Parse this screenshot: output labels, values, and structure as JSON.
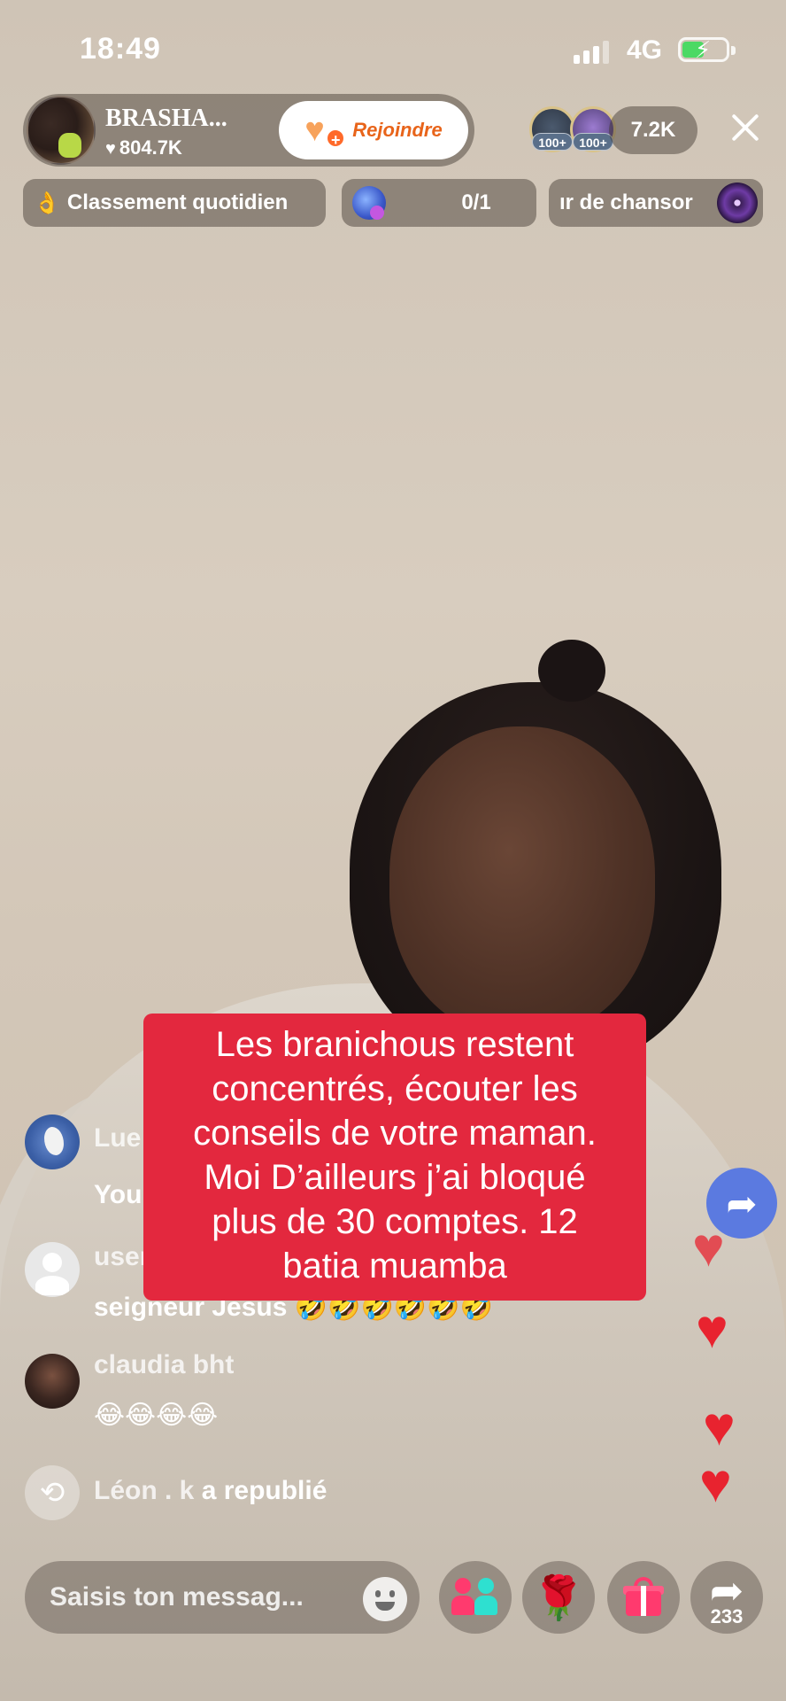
{
  "status_bar": {
    "time": "18:49",
    "network": "4G"
  },
  "host": {
    "name": "BRASHA...",
    "likes": "804.7K",
    "join_label": "Rejoindre"
  },
  "viewers": {
    "badges": [
      "100+",
      "100+"
    ],
    "count": "7.2K"
  },
  "chips": {
    "ranking": "Classement quotidien",
    "gift_progress": "0/1",
    "song": "ır de chansor"
  },
  "comments": [
    {
      "user": "Lue",
      "text": "You"
    },
    {
      "user": "user3",
      "text": "seigneur Jésus 🤣🤣🤣🤣🤣🤣"
    },
    {
      "user": "claudia bht",
      "text": "😂😂😂😂"
    }
  ],
  "repost": {
    "user": "Léon . k",
    "action": "a republié"
  },
  "caption": {
    "lines": [
      "Les branichous restent",
      "concentrés, écouter les",
      "conseils de votre maman.",
      "Moi D’ailleurs j’ai bloqué",
      "plus de 30 comptes. 12",
      "batia muamba"
    ]
  },
  "input": {
    "placeholder": "Saisis ton messag..."
  },
  "share": {
    "count": "233"
  },
  "colors": {
    "caption_bg": "#e3283e",
    "heart": "#e8232f",
    "join_text": "#e8641a"
  },
  "icons": [
    "heart-icon",
    "close-icon",
    "fire-icon",
    "gift-icon",
    "disc-icon",
    "repost-icon",
    "emoji-icon",
    "multi-guest-icon",
    "rose-icon",
    "gift-box-icon",
    "share-icon"
  ]
}
